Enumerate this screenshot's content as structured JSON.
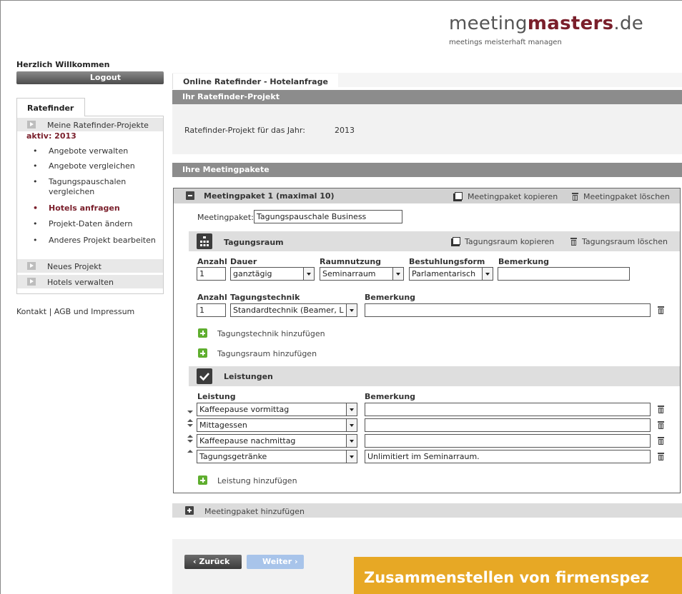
{
  "brand": {
    "logo_regular": "meeting",
    "logo_bold": "masters",
    "logo_suffix": ".de",
    "tagline": "meetings meisterhaft managen"
  },
  "sidebar": {
    "welcome": "Herzlich Willkommen",
    "logout_label": "Logout",
    "tab_label": "Ratefinder",
    "projects_label": "Meine Ratefinder-Projekte",
    "active_label": "aktiv: 2013",
    "sub_items": [
      {
        "label": "Angebote verwalten"
      },
      {
        "label": "Angebote vergleichen"
      },
      {
        "label": "Tagungspauschalen vergleichen"
      },
      {
        "label": "Hotels anfragen",
        "active": true
      },
      {
        "label": "Projekt-Daten ändern"
      },
      {
        "label": "Anderes Projekt bearbeiten"
      }
    ],
    "new_project_label": "Neues Projekt",
    "hotels_label": "Hotels verwalten",
    "footer": "Kontakt | AGB und Impressum"
  },
  "main": {
    "tab_label": "Online Ratefinder - Hotelanfrage",
    "project_bar": "Ihr Ratefinder-Projekt",
    "project_year_label": "Ratefinder-Projekt für das Jahr:",
    "project_year": "2013",
    "packages_bar": "Ihre Meetingpakete"
  },
  "paket": {
    "title": "Meetingpaket 1 (maximal 10)",
    "copy_label": "Meetingpaket kopieren",
    "delete_label": "Meetingpaket löschen",
    "name_label": "Meetingpaket:",
    "name_value": "Tagungspauschale Business"
  },
  "raum": {
    "title": "Tagungsraum",
    "copy_label": "Tagungsraum kopieren",
    "delete_label": "Tagungsraum löschen",
    "col_anzahl": "Anzahl",
    "col_dauer": "Dauer",
    "col_raumnutzung": "Raumnutzung",
    "col_bestuhlung": "Bestuhlungsform",
    "col_bemerkung": "Bemerkung",
    "anzahl": "1",
    "dauer": "ganztägig",
    "raumnutzung": "Seminarraum",
    "bestuhlung": "Parlamentarisch",
    "bemerkung": "",
    "tech_col_anzahl": "Anzahl",
    "tech_col_technik": "Tagungstechnik",
    "tech_col_bemerkung": "Bemerkung",
    "tech_anzahl": "1",
    "tech_value": "Standardtechnik (Beamer, L",
    "tech_bemerkung": "",
    "add_technik": "Tagungstechnik hinzufügen",
    "add_raum": "Tagungsraum hinzufügen"
  },
  "leistungen": {
    "title": "Leistungen",
    "col_leistung": "Leistung",
    "col_bemerkung": "Bemerkung",
    "rows": [
      {
        "value": "Kaffeepause vormittag",
        "bemerkung": ""
      },
      {
        "value": "Mittagessen",
        "bemerkung": ""
      },
      {
        "value": "Kaffeepause nachmittag",
        "bemerkung": ""
      },
      {
        "value": "Tagungsgetränke",
        "bemerkung": "Unlimitiert im Seminarraum."
      }
    ],
    "add_label": "Leistung hinzufügen"
  },
  "add_paket_label": "Meetingpaket hinzufügen",
  "nav": {
    "back_label": "Zurück",
    "next_label": "Weiter"
  },
  "banner_text": "Zusammenstellen von firmenspez",
  "colors": {
    "accent": "#7a1f2b",
    "bar_gray": "#8c8c8c",
    "banner": "#e7a825",
    "plus_green": "#5fae2f",
    "next_button": "#a8c4ea"
  }
}
